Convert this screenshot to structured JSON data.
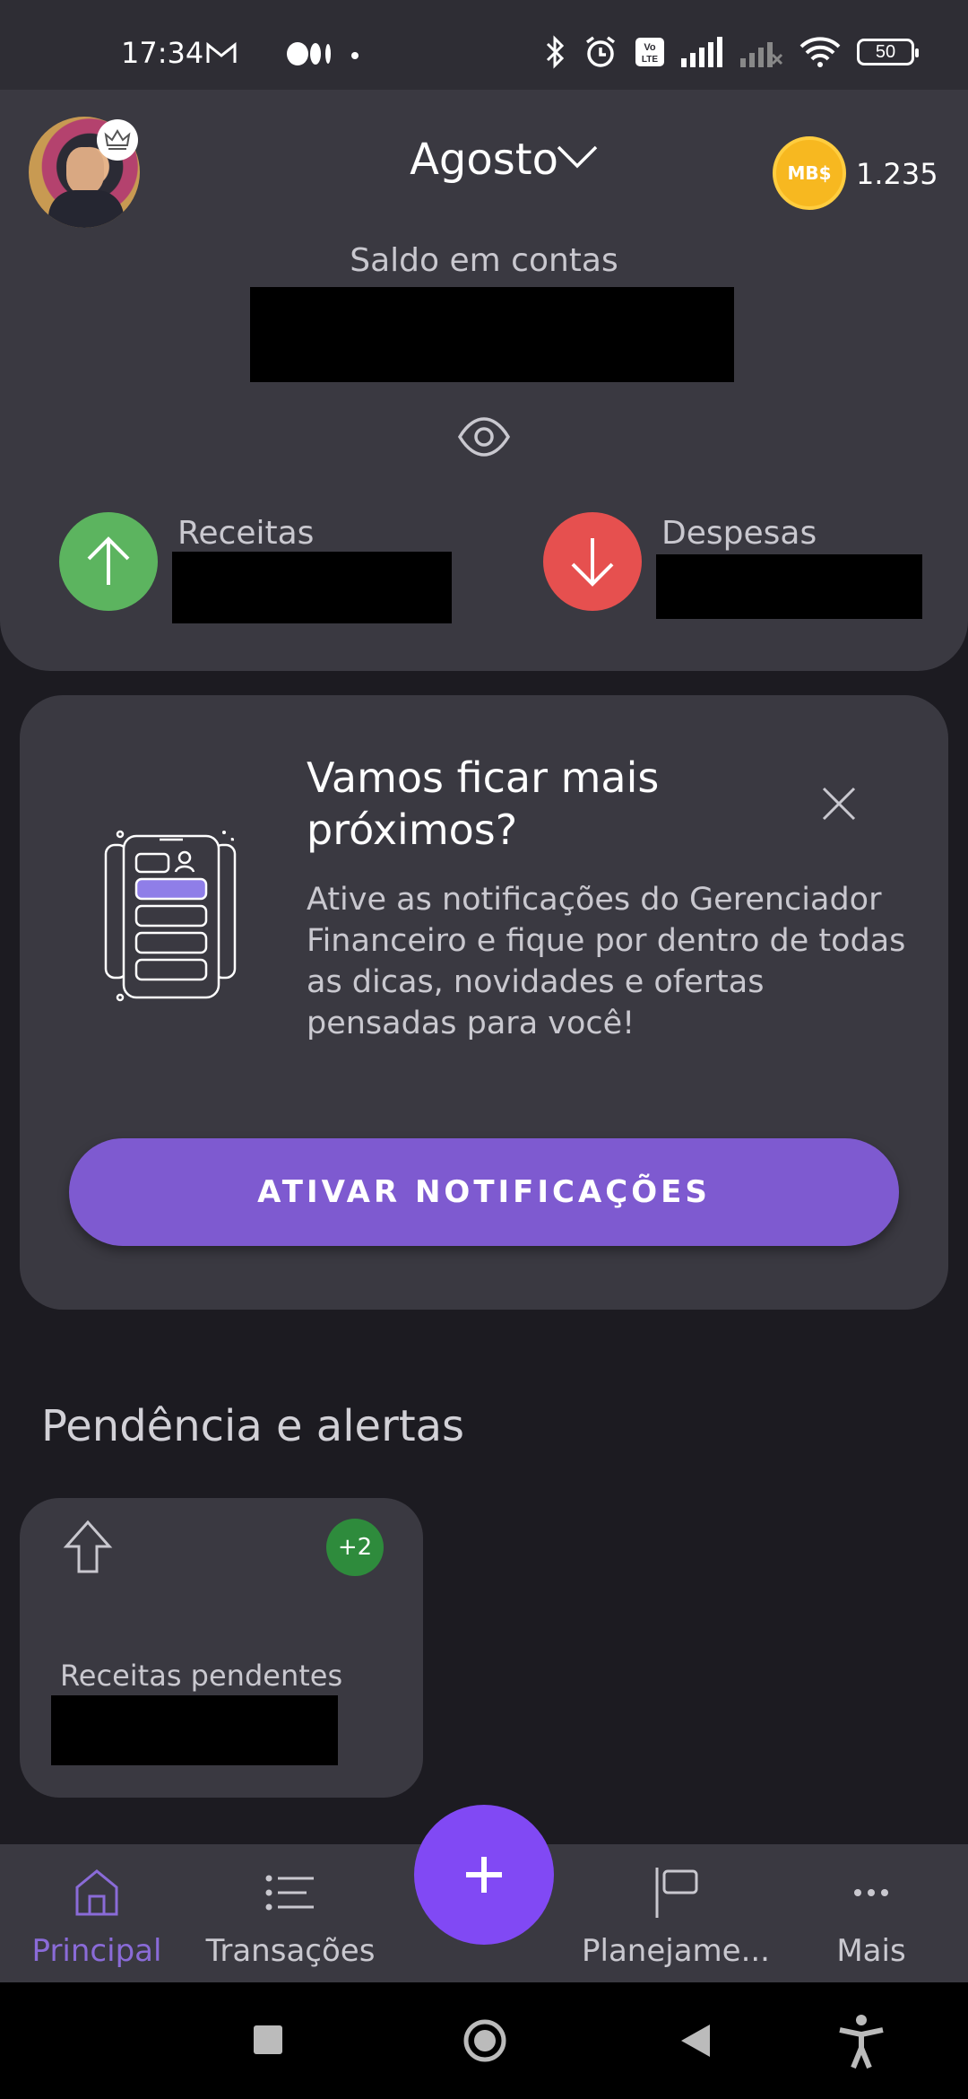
{
  "status_bar": {
    "time": "17:34",
    "battery": "50",
    "icons": [
      "gmail-icon",
      "medium-icon",
      "dot-icon",
      "bluetooth-icon",
      "alarm-icon",
      "volte-icon",
      "signal-icon",
      "signal-off-icon",
      "wifi-icon",
      "battery-icon"
    ]
  },
  "header": {
    "month": "Agosto",
    "coins": "1.235",
    "coin_label": "MB$",
    "balance_label": "Saldo em contas",
    "income_label": "Receitas",
    "expense_label": "Despesas"
  },
  "notification_card": {
    "title": "Vamos ficar mais próximos?",
    "body": "Ative as notificações do Gerenciador Financeiro e fique por dentro de todas as dicas, novidades e ofertas pensadas para você!",
    "cta": "ATIVAR NOTIFICAÇÕES"
  },
  "pending": {
    "title": "Pendência e alertas",
    "card_label": "Receitas pendentes",
    "badge": "+2"
  },
  "bottom_nav": {
    "items": [
      {
        "label": "Principal",
        "icon": "home-icon",
        "active": true
      },
      {
        "label": "Transações",
        "icon": "list-icon",
        "active": false
      },
      {
        "label": "Planejame...",
        "icon": "flag-icon",
        "active": false
      },
      {
        "label": "Mais",
        "icon": "more-icon",
        "active": false
      }
    ],
    "fab": "+"
  },
  "colors": {
    "accent": "#7e5ad0",
    "fab": "#8149f4",
    "income": "#5cb45f",
    "expense": "#e6504f",
    "card": "#3a3941",
    "background": "#1c1b21"
  }
}
